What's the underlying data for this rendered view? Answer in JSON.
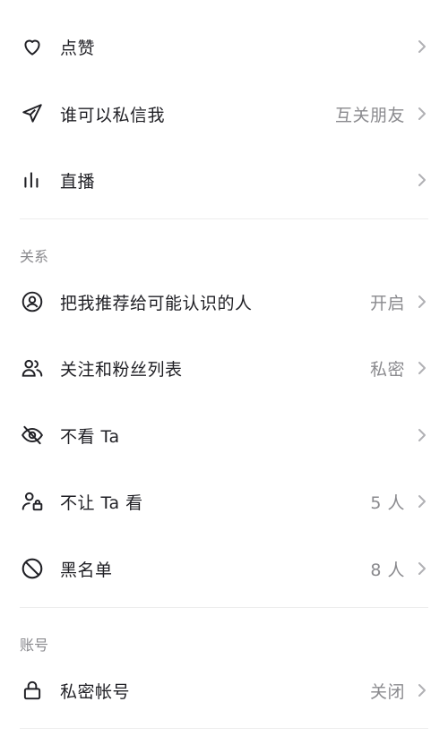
{
  "rows_top": [
    {
      "icon": "heart-icon",
      "label": "点赞",
      "value": ""
    },
    {
      "icon": "paper-plane-icon",
      "label": "谁可以私信我",
      "value": "互关朋友"
    },
    {
      "icon": "live-bars-icon",
      "label": "直播",
      "value": ""
    }
  ],
  "section_relation": {
    "title": "关系",
    "rows": [
      {
        "icon": "user-circle-icon",
        "label": "把我推荐给可能认识的人",
        "value": "开启"
      },
      {
        "icon": "users-icon",
        "label": "关注和粉丝列表",
        "value": "私密"
      },
      {
        "icon": "eye-off-icon",
        "label": "不看 Ta",
        "value": ""
      },
      {
        "icon": "user-lock-icon",
        "label": "不让 Ta 看",
        "value": "5 人"
      },
      {
        "icon": "block-icon",
        "label": "黑名单",
        "value": "8 人"
      }
    ]
  },
  "section_account": {
    "title": "账号",
    "rows": [
      {
        "icon": "lock-icon",
        "label": "私密帐号",
        "value": "关闭"
      }
    ]
  },
  "colors": {
    "text": "#1f1f24",
    "secondary": "#8a8a8e",
    "divider": "#ededed",
    "chevron": "#b0b0b4"
  }
}
